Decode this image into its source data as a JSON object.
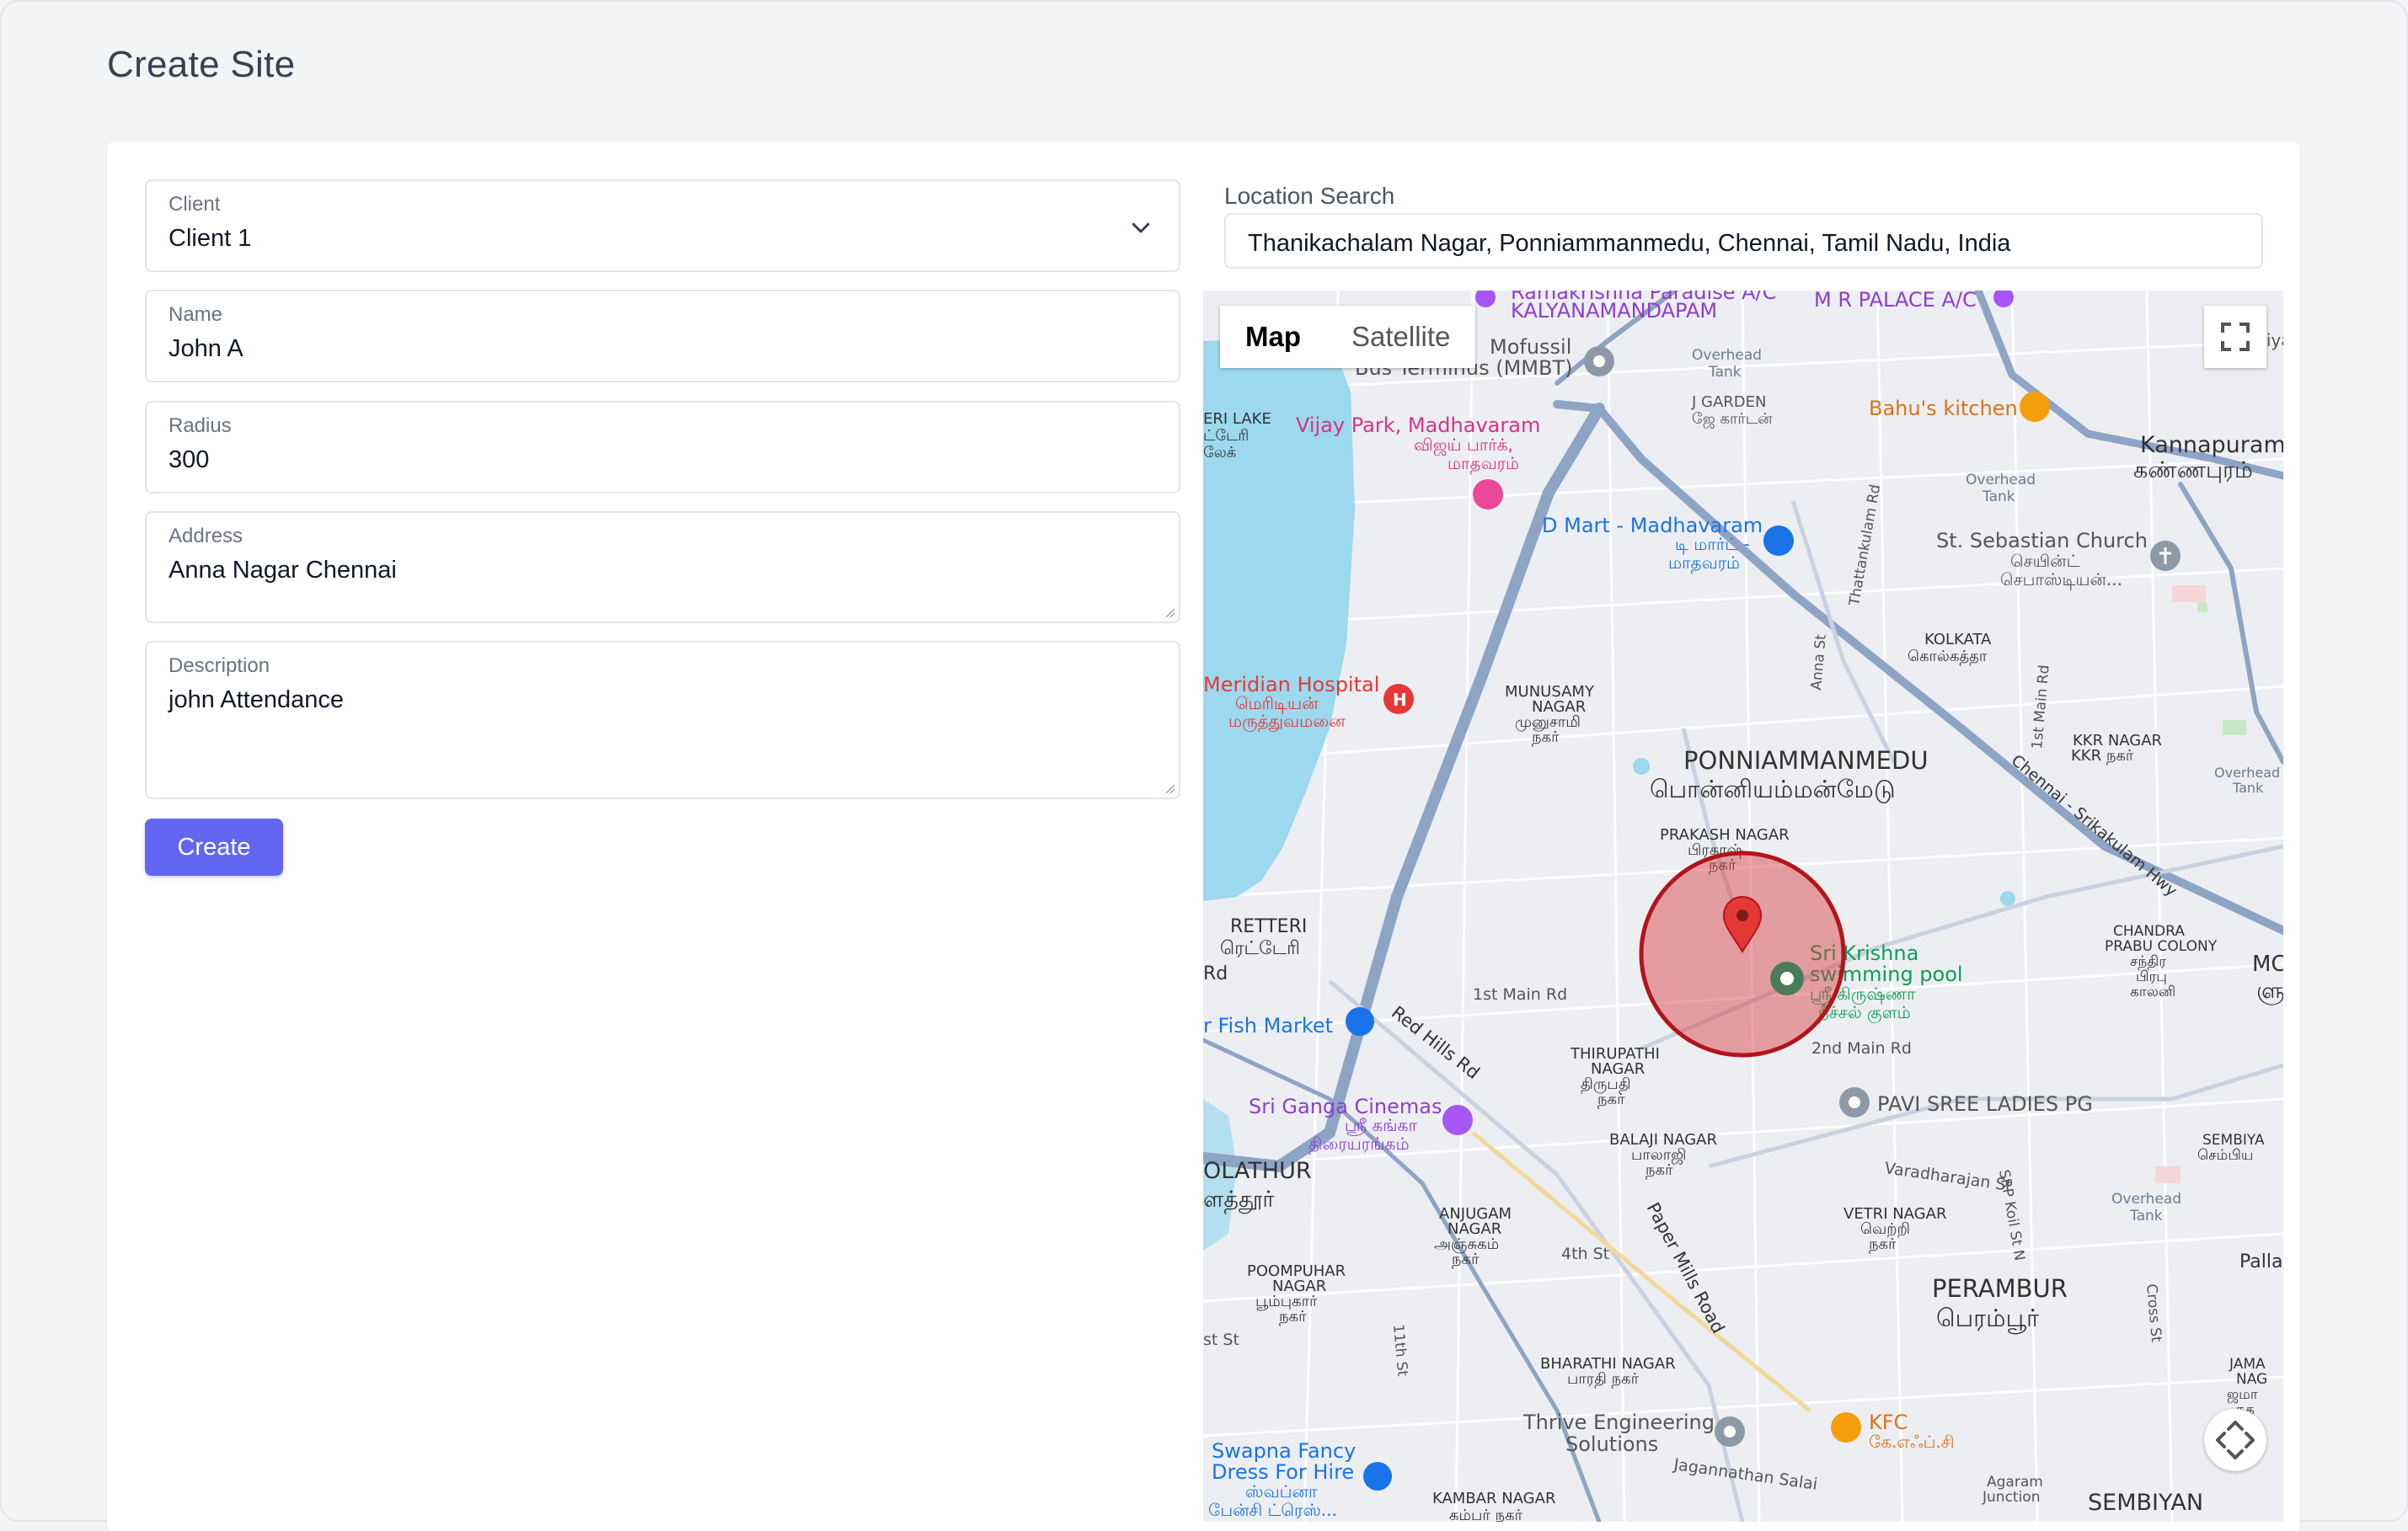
{
  "page": {
    "title": "Create Site"
  },
  "form": {
    "client": {
      "label": "Client",
      "value": "Client 1"
    },
    "name": {
      "label": "Name",
      "value": "John A"
    },
    "radius": {
      "label": "Radius",
      "value": "300"
    },
    "address": {
      "label": "Address",
      "value": "Anna Nagar Chennai"
    },
    "description": {
      "label": "Description",
      "value": "john Attendance"
    },
    "submit_label": "Create"
  },
  "location": {
    "label": "Location Search",
    "value": "Thanikachalam Nagar, Ponniammanmedu, Chennai, Tamil Nadu, India"
  },
  "map": {
    "toggle": {
      "map": "Map",
      "satellite": "Satellite"
    },
    "places": [
      {
        "name": "Ramakrishna Paradise A/C"
      },
      {
        "name": "KALYANAMANDAPAM"
      },
      {
        "name": "M R PALACE A/C"
      },
      {
        "name": "Periya"
      },
      {
        "name": "Mofussil"
      },
      {
        "name": "Bus Terminus (MMBT)"
      },
      {
        "name": "Overhead"
      },
      {
        "name": "Tank"
      },
      {
        "name": "J GARDEN"
      },
      {
        "name": "ஜே கார்டன்"
      },
      {
        "name": "Bahu's kitchen"
      },
      {
        "name": "Kannapuram"
      },
      {
        "name": "கண்ணபுரம்"
      },
      {
        "name": "ERI LAKE"
      },
      {
        "name": "ட்டேரி"
      },
      {
        "name": "லேக்"
      },
      {
        "name": "Vijay Park, Madhavaram"
      },
      {
        "name": "விஜய் பார்க்,"
      },
      {
        "name": "மாதவரம்"
      },
      {
        "name": "Overhead"
      },
      {
        "name": "Tank"
      },
      {
        "name": "D Mart - Madhavaram"
      },
      {
        "name": "டி மார்ட் -"
      },
      {
        "name": "மாதவரம்"
      },
      {
        "name": "St. Sebastian Church"
      },
      {
        "name": "செயின்ட்"
      },
      {
        "name": "செபாஸ்டியன்..."
      },
      {
        "name": "Thattankulam Rd"
      },
      {
        "name": "Anna St"
      },
      {
        "name": "KOLKATA"
      },
      {
        "name": "கொல்கத்தா"
      },
      {
        "name": "1st Main Rd"
      },
      {
        "name": "Meridian Hospital"
      },
      {
        "name": "மெரிடியன்"
      },
      {
        "name": "மருத்துவமனை"
      },
      {
        "name": "MUNUSAMY"
      },
      {
        "name": "NAGAR"
      },
      {
        "name": "முனுசாமி"
      },
      {
        "name": "நகர்"
      },
      {
        "name": "KKR NAGAR"
      },
      {
        "name": "KKR நகர்"
      },
      {
        "name": "Overhead"
      },
      {
        "name": "Tank"
      },
      {
        "name": "PONNIAMMANMEDU"
      },
      {
        "name": "பொன்னியம்மன்மேடு"
      },
      {
        "name": "Chennai - Srikakulam Hwy"
      },
      {
        "name": "PRAKASH NAGAR"
      },
      {
        "name": "பிரகாஷ்"
      },
      {
        "name": "நகர்"
      },
      {
        "name": "RETTERI"
      },
      {
        "name": "ரெட்டேரி"
      },
      {
        "name": "Rd"
      },
      {
        "name": "Sri Krishna"
      },
      {
        "name": "swimming pool"
      },
      {
        "name": "ஸ்ரீ கிருஷ்ணா"
      },
      {
        "name": "நீச்சல் குளம்"
      },
      {
        "name": "CHANDRA"
      },
      {
        "name": "PRABU COLONY"
      },
      {
        "name": "சந்திர"
      },
      {
        "name": "பிரபு"
      },
      {
        "name": "காலனி"
      },
      {
        "name": "MC"
      },
      {
        "name": "ளு"
      },
      {
        "name": "1st Main Rd"
      },
      {
        "name": "r Fish Market"
      },
      {
        "name": "Red Hills Rd"
      },
      {
        "name": "2nd Main Rd"
      },
      {
        "name": "THIRUPATHI"
      },
      {
        "name": "NAGAR"
      },
      {
        "name": "திருபதி"
      },
      {
        "name": "நகர்"
      },
      {
        "name": "PAVI SREE LADIES PG"
      },
      {
        "name": "Sri Ganga Cinemas"
      },
      {
        "name": "ஸ்ரீ கங்கா"
      },
      {
        "name": "திரையரங்கம்"
      },
      {
        "name": "BALAJI NAGAR"
      },
      {
        "name": "பாலாஜி"
      },
      {
        "name": "நகர்"
      },
      {
        "name": "SEMBIYA"
      },
      {
        "name": "செம்பிய"
      },
      {
        "name": "OLATHUR"
      },
      {
        "name": "ளத்தூர்"
      },
      {
        "name": "Varadharajan St"
      },
      {
        "name": "SRP Koil St N"
      },
      {
        "name": "Overhead"
      },
      {
        "name": "Tank"
      },
      {
        "name": "ANJUGAM"
      },
      {
        "name": "NAGAR"
      },
      {
        "name": "அஞ்சுகம்"
      },
      {
        "name": "நகர்"
      },
      {
        "name": "Paper Mills Road"
      },
      {
        "name": "VETRI NAGAR"
      },
      {
        "name": "வெற்றி"
      },
      {
        "name": "நகர்"
      },
      {
        "name": "4th St"
      },
      {
        "name": "POOMPUHAR"
      },
      {
        "name": "NAGAR"
      },
      {
        "name": "பூம்புகார்"
      },
      {
        "name": "நகர்"
      },
      {
        "name": "PERAMBUR"
      },
      {
        "name": "பெரம்பூர்"
      },
      {
        "name": "Palla"
      },
      {
        "name": "Cross St"
      },
      {
        "name": "st St"
      },
      {
        "name": "11th St"
      },
      {
        "name": "BHARATHI NAGAR"
      },
      {
        "name": "பாரதி நகர்"
      },
      {
        "name": "JAMA"
      },
      {
        "name": "NAG"
      },
      {
        "name": "ஜமா"
      },
      {
        "name": "நக"
      },
      {
        "name": "Thrive Engineering"
      },
      {
        "name": "Solutions"
      },
      {
        "name": "KFC"
      },
      {
        "name": "கே.எஃப்.சி"
      },
      {
        "name": "Swapna Fancy"
      },
      {
        "name": "Dress For Hire"
      },
      {
        "name": "ஸ்வப்னா"
      },
      {
        "name": "பேன்சி ட்ரெஸ்..."
      },
      {
        "name": "Jagannathan Salai"
      },
      {
        "name": "Agaram"
      },
      {
        "name": "Junction"
      },
      {
        "name": "KAMBAR NAGAR"
      },
      {
        "name": "கம்பர் நகர்"
      },
      {
        "name": "SEMBIYAN"
      }
    ]
  },
  "colors": {
    "primary": "#6366f1",
    "radius_fill": "#d9383a",
    "radius_stroke": "#b3141a",
    "map_water": "#9cd8ee",
    "map_road": "#8ea4c5"
  }
}
